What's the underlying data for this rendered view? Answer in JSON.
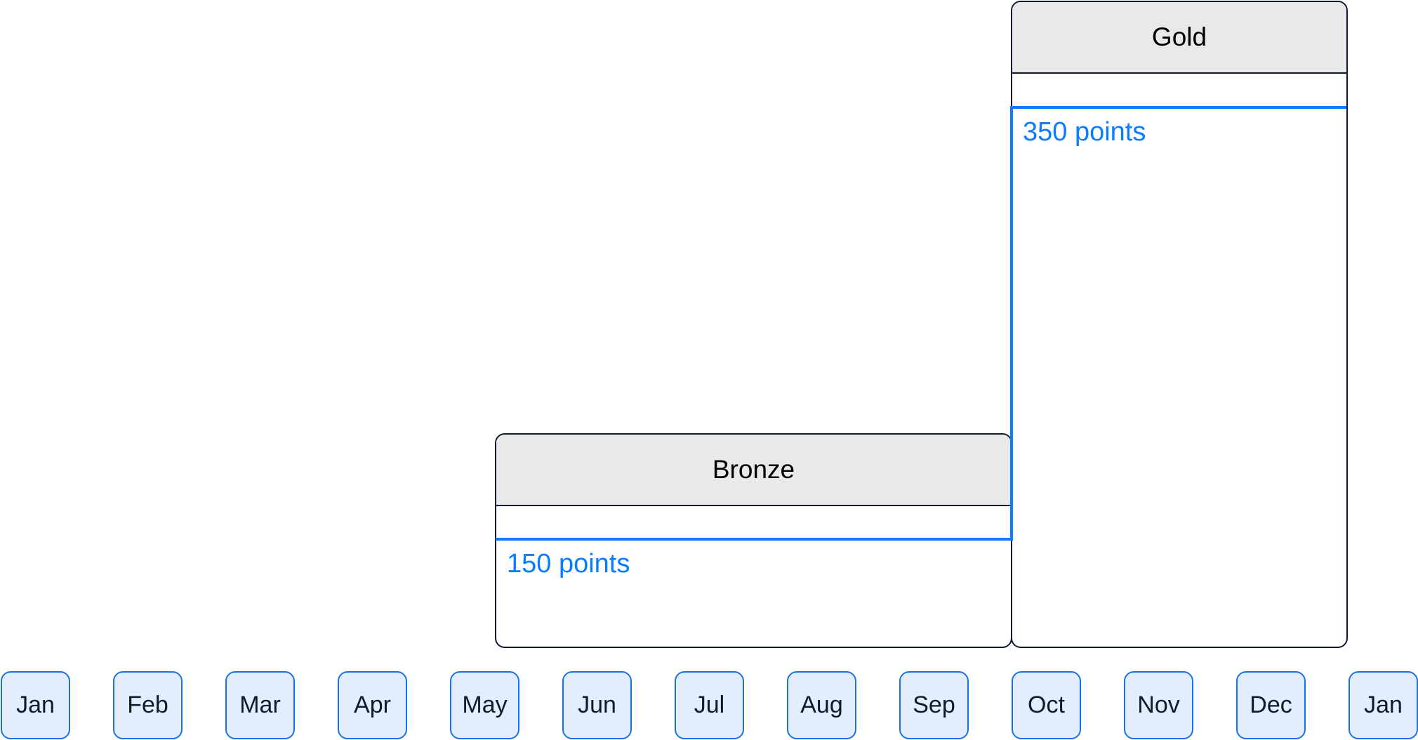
{
  "diagram": {
    "type": "tier-timeline",
    "accent_color": "#0a7cff",
    "header_fill": "#e9e9e9",
    "month_fill": "#e3edfd",
    "month_border": "#1a73e8",
    "tiers": [
      {
        "name": "Bronze",
        "points_label": "150 points",
        "points": 150,
        "start_month_index": 4.5,
        "end_month_index": 9
      },
      {
        "name": "Gold",
        "points_label": "350 points",
        "points": 350,
        "start_month_index": 9,
        "end_month_index": 12
      }
    ],
    "months": [
      "Jan",
      "Feb",
      "Mar",
      "Apr",
      "May",
      "Jun",
      "Jul",
      "Aug",
      "Sep",
      "Oct",
      "Nov",
      "Dec",
      "Jan"
    ]
  }
}
